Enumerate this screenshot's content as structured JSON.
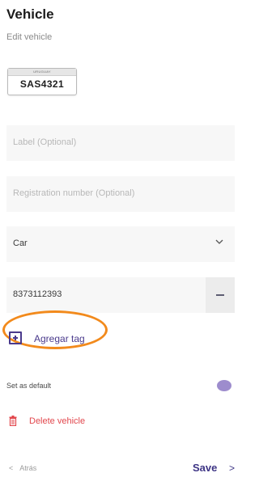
{
  "header": {
    "title": "Vehicle",
    "subtitle": "Edit vehicle"
  },
  "plate": {
    "country": "URUGUAY",
    "number": "SAS4321"
  },
  "form": {
    "label_placeholder": "Label (Optional)",
    "registration_placeholder": "Registration number (Optional)",
    "vehicle_type": "Car",
    "tag_value": "8373112393"
  },
  "actions": {
    "add_tag": "Agregar tag",
    "set_default": "Set as default",
    "delete_vehicle": "Delete vehicle"
  },
  "footer": {
    "back": "Atrás",
    "back_arrow": "<",
    "save": "Save",
    "next_arrow": ">"
  },
  "colors": {
    "accent": "#4a3a8c",
    "danger": "#e2474d",
    "toggle": "#9d8ccd",
    "highlight": "#f28a1c"
  },
  "icons": {
    "chevron": "chevron-down-icon",
    "minus": "minus-icon",
    "plus": "plus-square-icon",
    "trash": "trash-icon"
  }
}
